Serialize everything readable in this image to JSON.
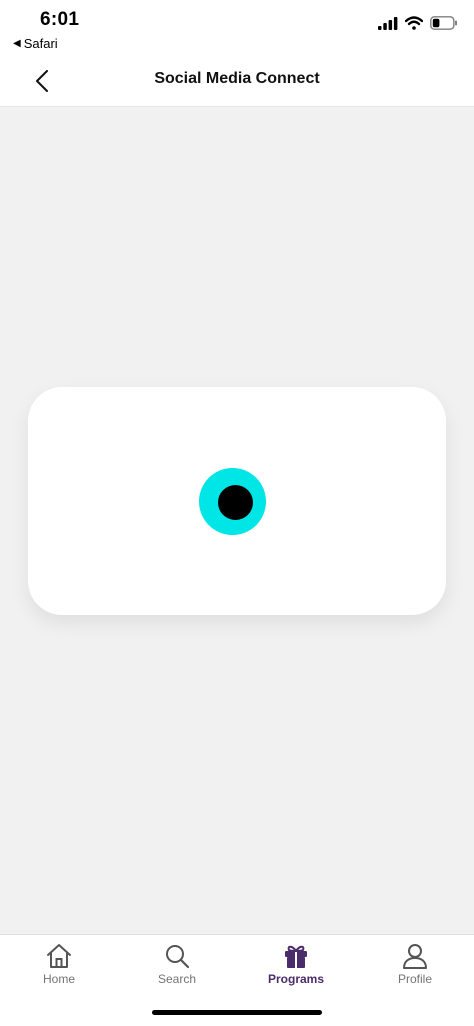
{
  "status_bar": {
    "time": "6:01",
    "back_app": "Safari",
    "back_glyph": "◀",
    "signal_icon": "cellular-signal-icon",
    "wifi_icon": "wifi-icon",
    "battery_icon": "battery-icon",
    "battery_level": 0.35
  },
  "nav": {
    "back_icon": "chevron-left-icon",
    "title": "Social Media Connect"
  },
  "card": {
    "loader_ring_color": "#00e5e5",
    "loader_dot_color": "#000000"
  },
  "tab_bar": {
    "active_color": "#4a2c6a",
    "inactive_color": "#737373",
    "tabs": [
      {
        "label": "Home",
        "icon": "home-icon",
        "active": false
      },
      {
        "label": "Search",
        "icon": "search-icon",
        "active": false
      },
      {
        "label": "Programs",
        "icon": "gift-icon",
        "active": true
      },
      {
        "label": "Profile",
        "icon": "profile-icon",
        "active": false
      }
    ]
  }
}
